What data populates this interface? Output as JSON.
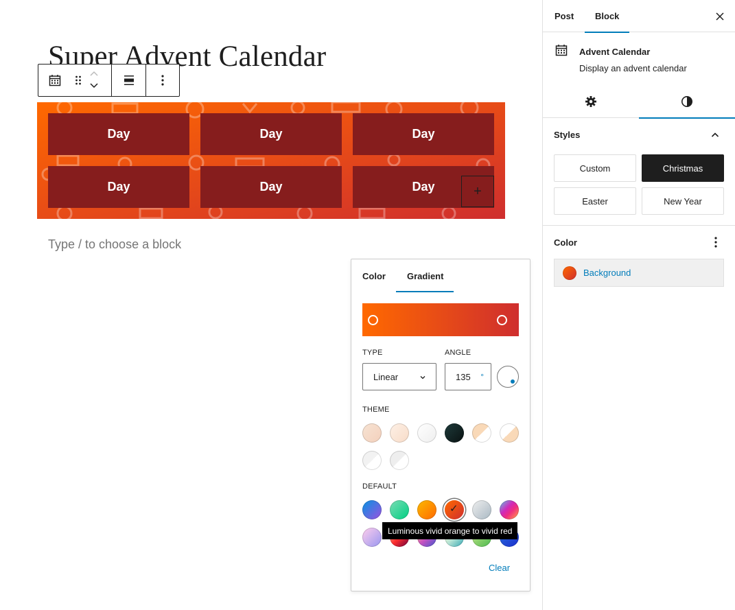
{
  "editor": {
    "title": "Super Advent Calendar",
    "placeholder": "Type / to choose a block",
    "toolbar": {
      "block_icon": "calendar-icon",
      "drag_icon": "drag-handle-icon",
      "move_up_icon": "chevron-up-icon",
      "move_down_icon": "chevron-down-icon",
      "align_icon": "align-wide-icon",
      "more_icon": "more-vertical-icon"
    },
    "calendar": {
      "days": [
        "Day",
        "Day",
        "Day",
        "Day",
        "Day",
        "Day"
      ],
      "appender": "+"
    }
  },
  "popover": {
    "tabs": [
      "Color",
      "Gradient"
    ],
    "active_tab": "Gradient",
    "type_label": "TYPE",
    "type_value": "Linear",
    "angle_label": "ANGLE",
    "angle_value": "135",
    "angle_unit": "°",
    "theme_label": "THEME",
    "default_label": "DEFAULT",
    "tooltip": "Luminous vivid orange to vivid red",
    "clear_label": "Clear",
    "gradient_colors": [
      "#ff6900",
      "#cf2e2e"
    ],
    "theme_swatches": [
      "linear-gradient(135deg,#f6e3d3 0%,#f4d0bc 100%)",
      "linear-gradient(135deg,#fdf0e6 0%,#f8dcc8 100%)",
      "linear-gradient(135deg,#ffffff 0%,#eeeeee 100%)",
      "linear-gradient(135deg,#1e3a3a 0%,#0a1212 100%)",
      "linear-gradient(135deg,#f9d9b8 50%,#ffffff 50%)",
      "linear-gradient(135deg,#ffffff 50%,#f9d9b8 50%)",
      "linear-gradient(135deg,#f2f2f2 50%,#ffffff 50%)",
      "linear-gradient(135deg,#eeeeee 50%,#ffffff 50%)"
    ],
    "default_swatches": [
      "linear-gradient(135deg,#0693e3 0%,#9b51e0 100%)",
      "linear-gradient(135deg,#7adcb4 0%,#00d082 100%)",
      "linear-gradient(135deg,#fcb900 0%,#ff6900 100%)",
      "linear-gradient(135deg,#ff6900 0%,#cf2e2e 100%)",
      "linear-gradient(135deg,#eeeeee 0%,#a9b8c3 100%)",
      "linear-gradient(135deg,#4aeadc 0%,#9778d1 20%,#cf2aba 40%,#ee2c82 60%,#fb6962 80%,#fef84c 100%)",
      "linear-gradient(135deg,#ffceec 0%,#9896f0 100%)",
      "linear-gradient(135deg,#fecda5 0%,#fe2d2d 50%,#6b003e 100%)",
      "linear-gradient(135deg,#ffcb70 0%,#c751c0 50%,#4158d0 100%)",
      "linear-gradient(135deg,#fff5cb 0%,#b6e3d4 50%,#33a7b5 100%)",
      "linear-gradient(135deg,#cae48a 0%,#4cbb4f 100%)",
      "linear-gradient(135deg,#2b6fd6 0%,#1b2fd1 100%)"
    ],
    "selected_default_index": 3
  },
  "sidebar": {
    "tabs": [
      "Post",
      "Block"
    ],
    "active_tab": "Block",
    "close_icon": "close-icon",
    "block": {
      "icon": "calendar-icon",
      "name": "Advent Calendar",
      "description": "Display an advent calendar"
    },
    "subtabs": [
      "settings-gear-icon",
      "styles-contrast-icon"
    ],
    "styles": {
      "title": "Styles",
      "options": [
        "Custom",
        "Christmas",
        "Easter",
        "New Year"
      ],
      "active": "Christmas"
    },
    "color": {
      "title": "Color",
      "menu_icon": "more-vertical-icon",
      "background_label": "Background",
      "background_swatch": "linear-gradient(135deg,#ff6900 0%,#cf2e2e 100%)"
    }
  },
  "colors": {
    "accent": "#007cba",
    "day_tile": "#861d1d",
    "dark": "#1e1e1e"
  }
}
